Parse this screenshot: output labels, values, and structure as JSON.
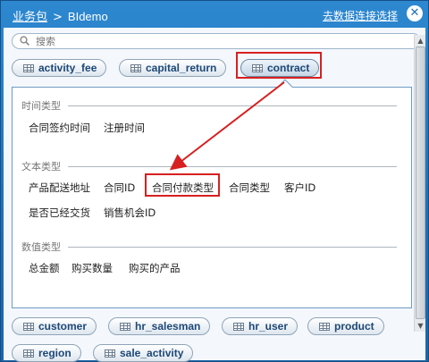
{
  "header": {
    "breadcrumb_root": "业务包",
    "breadcrumb_sep": ">",
    "breadcrumb_current": "BIdemo",
    "goto_link": "去数据连接选择",
    "close_symbol": "✕"
  },
  "search": {
    "placeholder": "搜索"
  },
  "tables_top": [
    "activity_fee",
    "capital_return",
    "contract"
  ],
  "active_table": "contract",
  "sections": [
    {
      "heading": "时间类型",
      "fields": [
        "合同签约时间",
        "注册时间"
      ]
    },
    {
      "heading": "文本类型",
      "fields": [
        "产品配送地址",
        "合同ID",
        "合同付款类型",
        "合同类型",
        "客户ID",
        "是否已经交货",
        "销售机会ID"
      ]
    },
    {
      "heading": "数值类型",
      "fields": [
        "总金额",
        "购买数量",
        "购买的产品"
      ]
    }
  ],
  "highlighted_field": "合同付款类型",
  "tables_bottom": [
    "customer",
    "hr_salesman",
    "hr_user",
    "product",
    "region",
    "sale_activity"
  ],
  "colors": {
    "window_blue": "#1f6fb5",
    "annotation_red": "#d72020",
    "pill_text": "#1d4877"
  }
}
